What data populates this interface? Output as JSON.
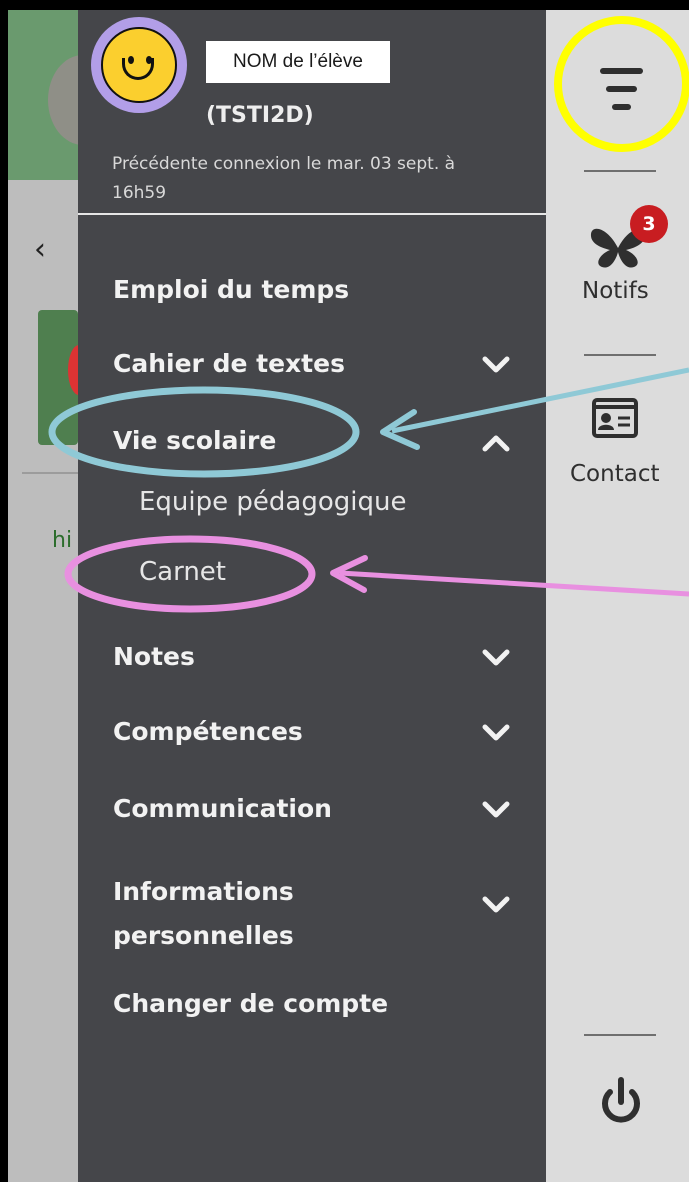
{
  "profile": {
    "name_label": "NOM de l’élève",
    "class": "(TSTI2D)",
    "last_connection": "Précédente connexion le mar. 03 sept. à 16h59",
    "avatar_icon": "smiley-avatar-icon"
  },
  "menu": {
    "items": [
      {
        "label": "Emploi du temps",
        "chevron": "none"
      },
      {
        "label": "Cahier de textes",
        "chevron": "down"
      },
      {
        "label": "Vie scolaire",
        "chevron": "up"
      },
      {
        "label": "Notes",
        "chevron": "down"
      },
      {
        "label": "Compétences",
        "chevron": "down"
      },
      {
        "label": "Communication",
        "chevron": "down"
      },
      {
        "label": "Informations personnelles",
        "chevron": "down"
      },
      {
        "label": "Changer de compte",
        "chevron": "none"
      }
    ],
    "vie_scolaire_subitems": [
      {
        "label": "Equipe pédagogique"
      },
      {
        "label": "Carnet"
      }
    ]
  },
  "rail": {
    "notifs_label": "Notifs",
    "notifs_count": "3",
    "contact_label": "Contact"
  },
  "annotations": {
    "menu_button_circle_color": "#ffff00",
    "vie_scolaire_circle_color": "#8fc9d6",
    "carnet_circle_color": "#e890e0"
  },
  "colors": {
    "panel": "#45464a",
    "rail": "#dcdcdc",
    "badge": "#c81d21"
  }
}
